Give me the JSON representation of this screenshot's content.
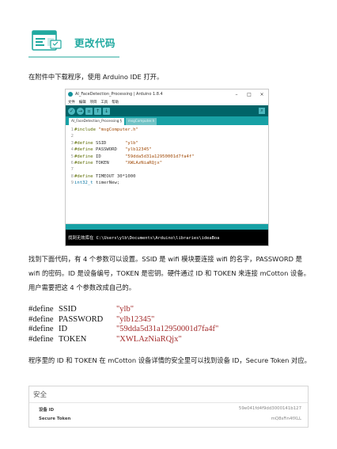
{
  "section": {
    "title": "更改代码"
  },
  "paragraphs": {
    "p1": "在附件中下载程序，使用 Arduino IDE 打开。",
    "p2": "找到下面代码，有 4 个参数可以设置。SSID 是 wifi 模块要连接 wifi 的名字，PASSWORD 是 wifi 的密码。ID 是设备编号，TOKEN 是密钥。硬件通过 ID 和 TOKEN 来连接 mCotton 设备。用户需要把这 4 个参数改成自己的。",
    "p3": "程序里的 ID 和 TOKEN 在 mCotton 设备详情的安全里可以找到设备 ID，Secure Token 对应。"
  },
  "ide": {
    "window_title": "AI_FaceDetection_Processing | Arduino 1.8.4",
    "menu": [
      "文件",
      "编辑",
      "项目",
      "工具",
      "帮助"
    ],
    "tabs": [
      "AI_FaceDetection_Processing §",
      "msgComputer.h"
    ],
    "toolbar_icons": [
      "verify-icon",
      "upload-icon",
      "new-icon",
      "open-icon",
      "save-icon",
      "serial-monitor-icon"
    ],
    "code_lines": [
      {
        "n": "1",
        "a": "#include ",
        "b": "",
        "c": "\"msgComputer.h\""
      },
      {
        "n": "2",
        "a": "",
        "b": "",
        "c": ""
      },
      {
        "n": "3",
        "a": "#define ",
        "b": "SSID       ",
        "c": "\"ylb\""
      },
      {
        "n": "4",
        "a": "#define ",
        "b": "PASSWORD   ",
        "c": "\"ylb12345\""
      },
      {
        "n": "5",
        "a": "#define ",
        "b": "ID         ",
        "c": "\"59dda5d31a12950001d7fa4f\""
      },
      {
        "n": "6",
        "a": "#define ",
        "b": "TOKEN      ",
        "c": "\"XWLAzNiaRQjx\""
      },
      {
        "n": "7",
        "a": "",
        "b": "",
        "c": ""
      },
      {
        "n": "8",
        "a": "#define ",
        "b": "TIMEOUT 30*1000",
        "c": ""
      },
      {
        "n": "9",
        "a": "int32_t ",
        "b": "timerNew;",
        "c": ""
      }
    ],
    "console_text": "找到无效库在 C:\\Users\\ylb\\Documents\\Arduino\\libraries\\ideaBoa"
  },
  "defines": [
    {
      "kw": "#define",
      "name": "SSID",
      "value": "\"ylb\""
    },
    {
      "kw": "#define",
      "name": "PASSWORD",
      "value": "\"ylb12345\""
    },
    {
      "kw": "#define",
      "name": "ID",
      "value": "\"59dda5d31a12950001d7fa4f\""
    },
    {
      "kw": "#define",
      "name": "TOKEN",
      "value": "\"XWLAzNiaRQjx\""
    }
  ],
  "security": {
    "title": "安全",
    "device_id_label": "设备 ID",
    "device_id_value": "59e041fd4f9dd3000141b127",
    "token_label": "Secure Token",
    "token_value": "mQ8sFin4fXLL"
  },
  "colors": {
    "accent": "#21a9a0",
    "ide_toolbar": "#006468",
    "ide_tabbar": "#17a1a5",
    "define_value": "#a32a2a"
  }
}
